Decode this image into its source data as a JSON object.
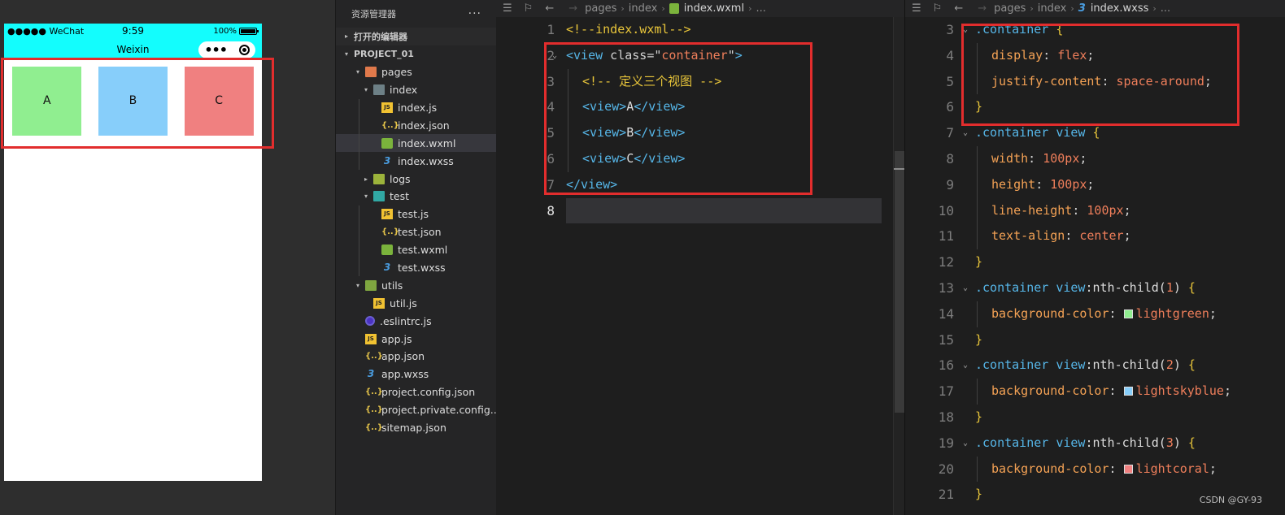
{
  "simulator": {
    "carrier": "●●●●● WeChat",
    "clock": "9:59",
    "battery": "100%",
    "title": "Weixin",
    "capsule_dots": "•••",
    "boxes": [
      {
        "label": "A",
        "color": "#90ee90"
      },
      {
        "label": "B",
        "color": "#87cefa"
      },
      {
        "label": "C",
        "color": "#f08080"
      }
    ],
    "nav_color": "#13fdfd",
    "highlight_color": "#e22d2d"
  },
  "explorer": {
    "title": "资源管理器",
    "more": "···",
    "open_editors": "打开的编辑器",
    "project": "PROJECT_01",
    "items": [
      {
        "label": "pages",
        "icon": "folder-pages",
        "arrow": "▾",
        "depth": 1
      },
      {
        "label": "index",
        "icon": "folder",
        "arrow": "▾",
        "depth": 2
      },
      {
        "label": "index.js",
        "icon": "js",
        "depth": 3
      },
      {
        "label": "index.json",
        "icon": "json",
        "depth": 3
      },
      {
        "label": "index.wxml",
        "icon": "wxml",
        "depth": 3,
        "selected": true
      },
      {
        "label": "index.wxss",
        "icon": "wxss",
        "depth": 3
      },
      {
        "label": "logs",
        "icon": "folder-logs",
        "arrow": "▸",
        "depth": 2
      },
      {
        "label": "test",
        "icon": "folder-test",
        "arrow": "▾",
        "depth": 2
      },
      {
        "label": "test.js",
        "icon": "js",
        "depth": 3
      },
      {
        "label": "test.json",
        "icon": "json",
        "depth": 3
      },
      {
        "label": "test.wxml",
        "icon": "wxml",
        "depth": 3
      },
      {
        "label": "test.wxss",
        "icon": "wxss",
        "depth": 3
      },
      {
        "label": "utils",
        "icon": "folder-utils",
        "arrow": "▾",
        "depth": 1
      },
      {
        "label": "util.js",
        "icon": "js",
        "depth": 2
      },
      {
        "label": ".eslintrc.js",
        "icon": "eslint",
        "depth": 1
      },
      {
        "label": "app.js",
        "icon": "js",
        "depth": 1
      },
      {
        "label": "app.json",
        "icon": "json",
        "depth": 1
      },
      {
        "label": "app.wxss",
        "icon": "wxss",
        "depth": 1
      },
      {
        "label": "project.config.json",
        "icon": "json",
        "depth": 1
      },
      {
        "label": "project.private.config...",
        "icon": "json",
        "depth": 1
      },
      {
        "label": "sitemap.json",
        "icon": "json",
        "depth": 1
      }
    ]
  },
  "wxml_editor": {
    "breadcrumb": [
      "pages",
      "index",
      "index.wxml",
      "..."
    ],
    "lines": [
      {
        "n": "1",
        "tokens": [
          [
            "com",
            "<!--index.wxml-->"
          ]
        ]
      },
      {
        "n": "2",
        "fold": true,
        "tokens": [
          [
            "tag",
            "<view"
          ],
          [
            "attr",
            " class="
          ],
          [
            "punc",
            "\""
          ],
          [
            "str",
            "container"
          ],
          [
            "punc",
            "\""
          ],
          [
            "tag",
            ">"
          ]
        ]
      },
      {
        "n": "3",
        "indent": 1,
        "tokens": [
          [
            "com",
            "<!-- 定义三个视图 -->"
          ]
        ]
      },
      {
        "n": "4",
        "indent": 1,
        "tokens": [
          [
            "tag",
            "<view>"
          ],
          [
            "text",
            "A"
          ],
          [
            "tag",
            "</view>"
          ]
        ]
      },
      {
        "n": "5",
        "indent": 1,
        "tokens": [
          [
            "tag",
            "<view>"
          ],
          [
            "text",
            "B"
          ],
          [
            "tag",
            "</view>"
          ]
        ]
      },
      {
        "n": "6",
        "indent": 1,
        "tokens": [
          [
            "tag",
            "<view>"
          ],
          [
            "text",
            "C"
          ],
          [
            "tag",
            "</view>"
          ]
        ]
      },
      {
        "n": "7",
        "tokens": [
          [
            "tag",
            "</view>"
          ]
        ]
      },
      {
        "n": "8",
        "active": true,
        "tokens": []
      }
    ]
  },
  "wxss_editor": {
    "breadcrumb": [
      "pages",
      "index",
      "index.wxss",
      "..."
    ],
    "lines": [
      {
        "n": "3",
        "fold": true,
        "tokens": [
          [
            "sel",
            ".container "
          ],
          [
            "brace",
            "{"
          ]
        ]
      },
      {
        "n": "4",
        "indent": 1,
        "tokens": [
          [
            "prop",
            "display"
          ],
          [
            "punc",
            ": "
          ],
          [
            "val",
            "flex"
          ],
          [
            "punc",
            ";"
          ]
        ]
      },
      {
        "n": "5",
        "indent": 1,
        "tokens": [
          [
            "prop",
            "justify-content"
          ],
          [
            "punc",
            ": "
          ],
          [
            "val",
            "space-around"
          ],
          [
            "punc",
            ";"
          ]
        ]
      },
      {
        "n": "6",
        "tokens": [
          [
            "brace",
            "}"
          ]
        ]
      },
      {
        "n": "7",
        "fold": true,
        "tokens": [
          [
            "sel",
            ".container view "
          ],
          [
            "brace",
            "{"
          ]
        ]
      },
      {
        "n": "8",
        "indent": 1,
        "tokens": [
          [
            "prop",
            "width"
          ],
          [
            "punc",
            ": "
          ],
          [
            "val",
            "100px"
          ],
          [
            "punc",
            ";"
          ]
        ]
      },
      {
        "n": "9",
        "indent": 1,
        "tokens": [
          [
            "prop",
            "height"
          ],
          [
            "punc",
            ": "
          ],
          [
            "val",
            "100px"
          ],
          [
            "punc",
            ";"
          ]
        ]
      },
      {
        "n": "10",
        "indent": 1,
        "tokens": [
          [
            "prop",
            "line-height"
          ],
          [
            "punc",
            ": "
          ],
          [
            "val",
            "100px"
          ],
          [
            "punc",
            ";"
          ]
        ]
      },
      {
        "n": "11",
        "indent": 1,
        "tokens": [
          [
            "prop",
            "text-align"
          ],
          [
            "punc",
            ": "
          ],
          [
            "val",
            "center"
          ],
          [
            "punc",
            ";"
          ]
        ]
      },
      {
        "n": "12",
        "tokens": [
          [
            "brace",
            "}"
          ]
        ]
      },
      {
        "n": "13",
        "fold": true,
        "tokens": [
          [
            "sel",
            ".container view"
          ],
          [
            "text",
            ":nth-child("
          ],
          [
            "val",
            "1"
          ],
          [
            "text",
            ") "
          ],
          [
            "brace",
            "{"
          ]
        ]
      },
      {
        "n": "14",
        "indent": 1,
        "swatch": "#90ee90",
        "tokens": [
          [
            "prop",
            "background-color"
          ],
          [
            "punc",
            ": "
          ],
          [
            "swatch",
            ""
          ],
          [
            "val",
            "lightgreen"
          ],
          [
            "punc",
            ";"
          ]
        ]
      },
      {
        "n": "15",
        "tokens": [
          [
            "brace",
            "}"
          ]
        ]
      },
      {
        "n": "16",
        "fold": true,
        "tokens": [
          [
            "sel",
            ".container view"
          ],
          [
            "text",
            ":nth-child("
          ],
          [
            "val",
            "2"
          ],
          [
            "text",
            ") "
          ],
          [
            "brace",
            "{"
          ]
        ]
      },
      {
        "n": "17",
        "indent": 1,
        "swatch": "#87cefa",
        "tokens": [
          [
            "prop",
            "background-color"
          ],
          [
            "punc",
            ": "
          ],
          [
            "swatch",
            ""
          ],
          [
            "val",
            "lightskyblue"
          ],
          [
            "punc",
            ";"
          ]
        ]
      },
      {
        "n": "18",
        "tokens": [
          [
            "brace",
            "}"
          ]
        ]
      },
      {
        "n": "19",
        "fold": true,
        "tokens": [
          [
            "sel",
            ".container view"
          ],
          [
            "text",
            ":nth-child("
          ],
          [
            "val",
            "3"
          ],
          [
            "text",
            ") "
          ],
          [
            "brace",
            "{"
          ]
        ]
      },
      {
        "n": "20",
        "indent": 1,
        "swatch": "#f08080",
        "tokens": [
          [
            "prop",
            "background-color"
          ],
          [
            "punc",
            ": "
          ],
          [
            "swatch",
            ""
          ],
          [
            "val",
            "lightcoral"
          ],
          [
            "punc",
            ";"
          ]
        ]
      },
      {
        "n": "21",
        "tokens": [
          [
            "brace",
            "}"
          ]
        ]
      }
    ]
  },
  "watermark": "CSDN @GY-93"
}
